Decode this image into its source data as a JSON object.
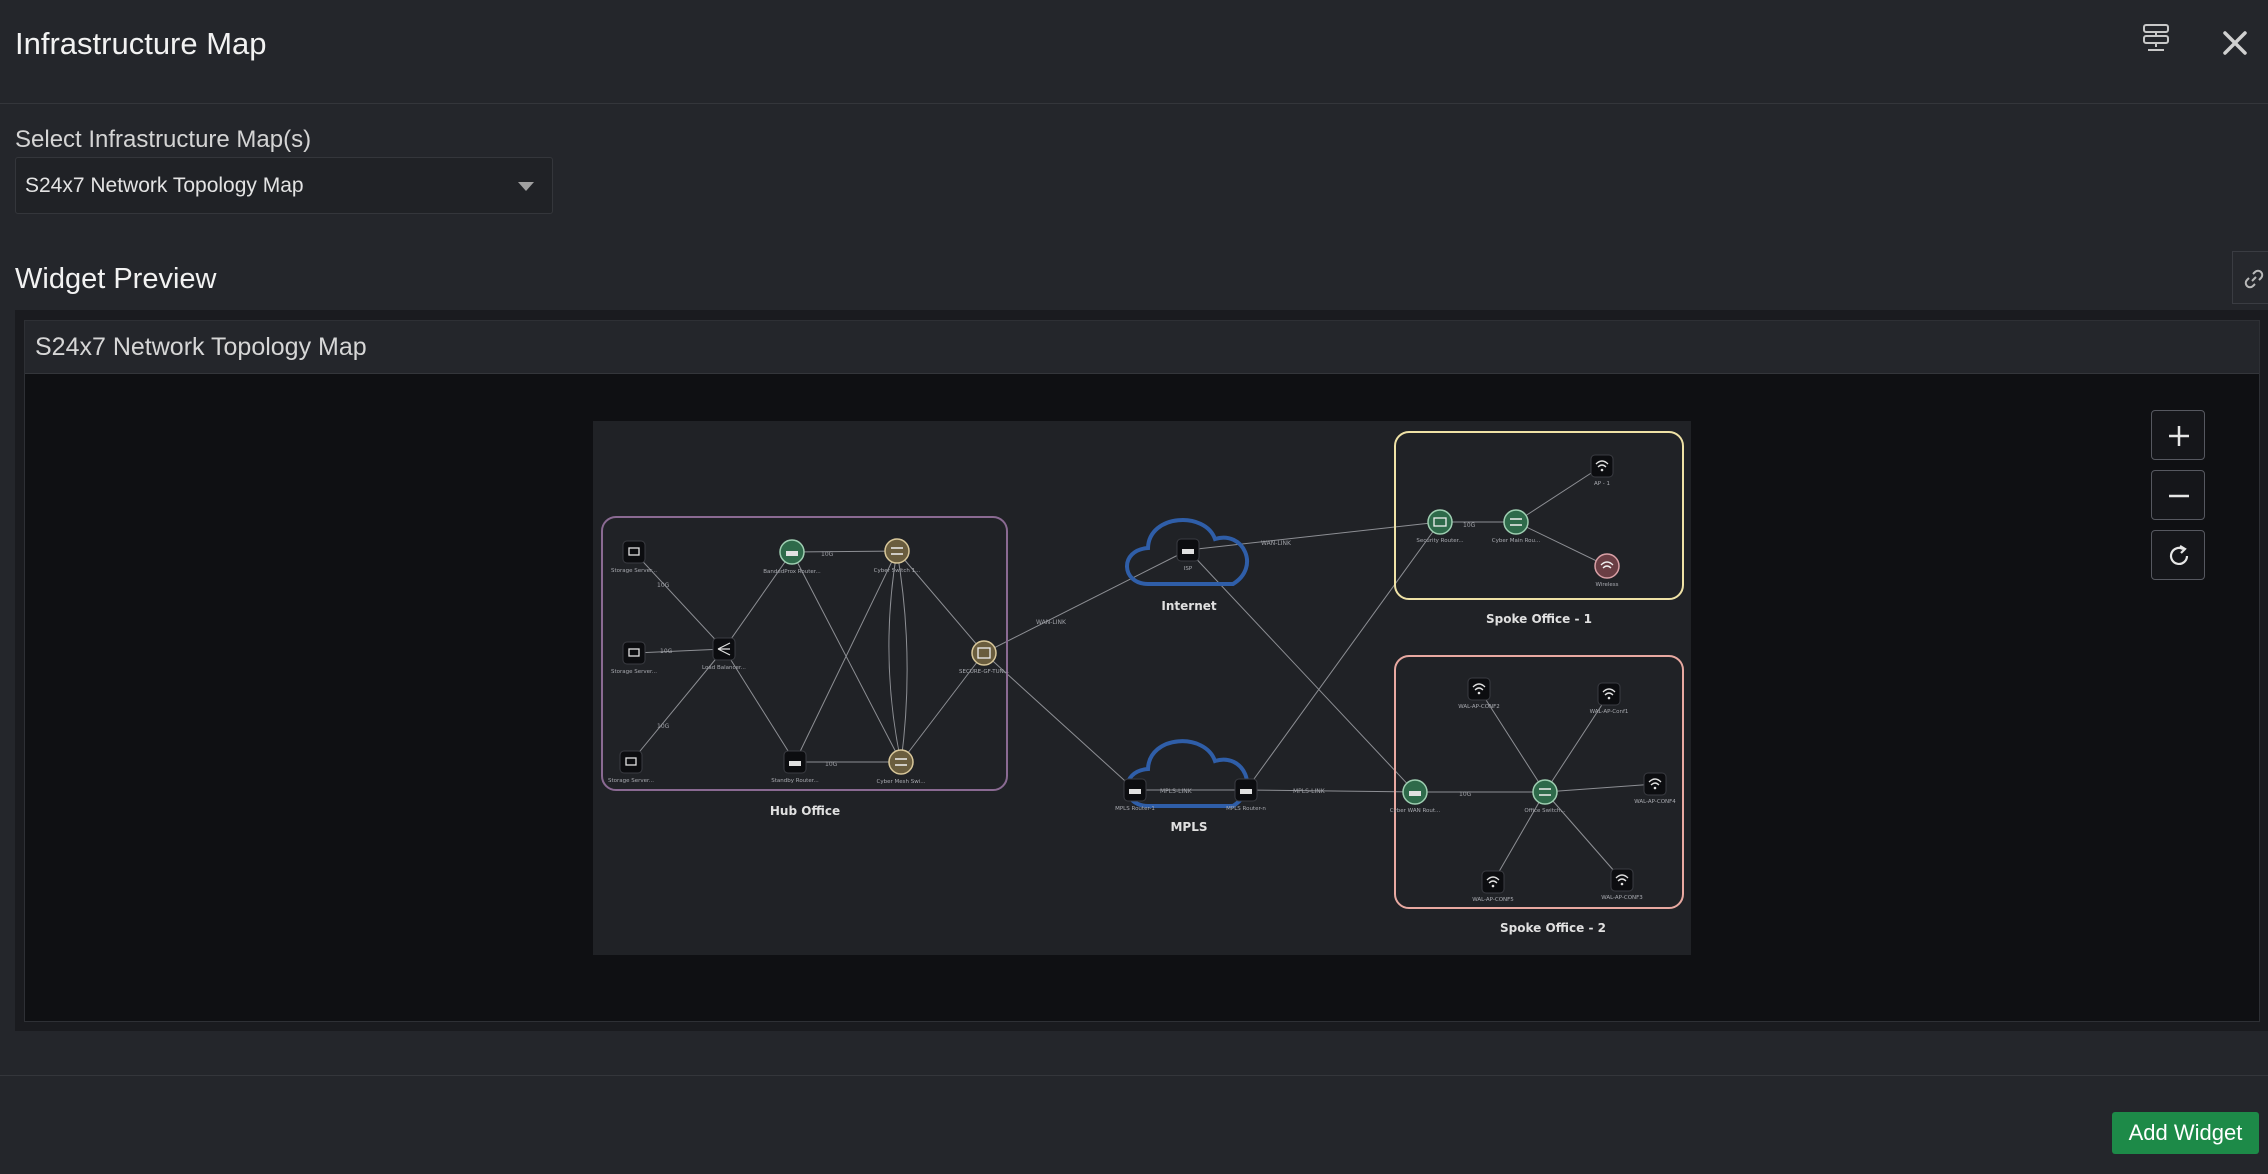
{
  "header": {
    "title": "Infrastructure Map",
    "icons": [
      "layout-icon",
      "close-icon"
    ]
  },
  "selector": {
    "label": "Select Infrastructure Map(s)",
    "value": "S24x7 Network Topology Map"
  },
  "preview": {
    "title": "Widget Preview",
    "widget_title": "S24x7 Network Topology Map"
  },
  "map": {
    "groups": {
      "hub": "Hub Office",
      "spoke1": "Spoke Office - 1",
      "spoke2": "Spoke Office - 2",
      "internet": "Internet",
      "mpls": "MPLS"
    },
    "nodes": {
      "storage1": "Storage Server...",
      "storage2": "Storage Server...",
      "storage3": "Storage Server...",
      "main_router": "BandedProx Router...",
      "core_switch": "Cyber Switch 1...",
      "load_balancer": "Load Balancer...",
      "standby_router": "Standby Router...",
      "spine_switch": "Cyber Mesh Swi...",
      "firewall": "SECURE-GF-TUN...",
      "isp": "ISP",
      "mpls_r1": "MPLS Router-1",
      "mpls_r2": "MPLS Router-n",
      "s1_router": "Security Router...",
      "s1_switch": "Cyber Main Rou...",
      "ap1": "AP - 1",
      "wireless": "Wireless",
      "s2_router": "Cyber WAN Rout...",
      "office_switch": "Office Switch...",
      "wap1": "WAL-AP-CONF2",
      "wap2": "WAL-AP-Conf1",
      "wap3": "WAL-AP-CONF4",
      "wap4": "WAL-AP-CONF5",
      "wap5": "WAL-AP-CONF3"
    },
    "links": {
      "l_10g": "10G",
      "l_mpls": "MPLS-LINK",
      "l_wan": "WAN-LINK"
    }
  },
  "controls": {
    "zoom_in": "+",
    "zoom_out": "−",
    "reset": "reset-icon"
  },
  "footer": {
    "add_label": "Add Widget"
  },
  "colors": {
    "accent_green": "#1d8a48",
    "hub_border": "#8a6a92",
    "spoke1_border": "#efe2a6",
    "spoke2_border": "#e8a9a1",
    "cloud_blue": "#2f5ea8"
  }
}
